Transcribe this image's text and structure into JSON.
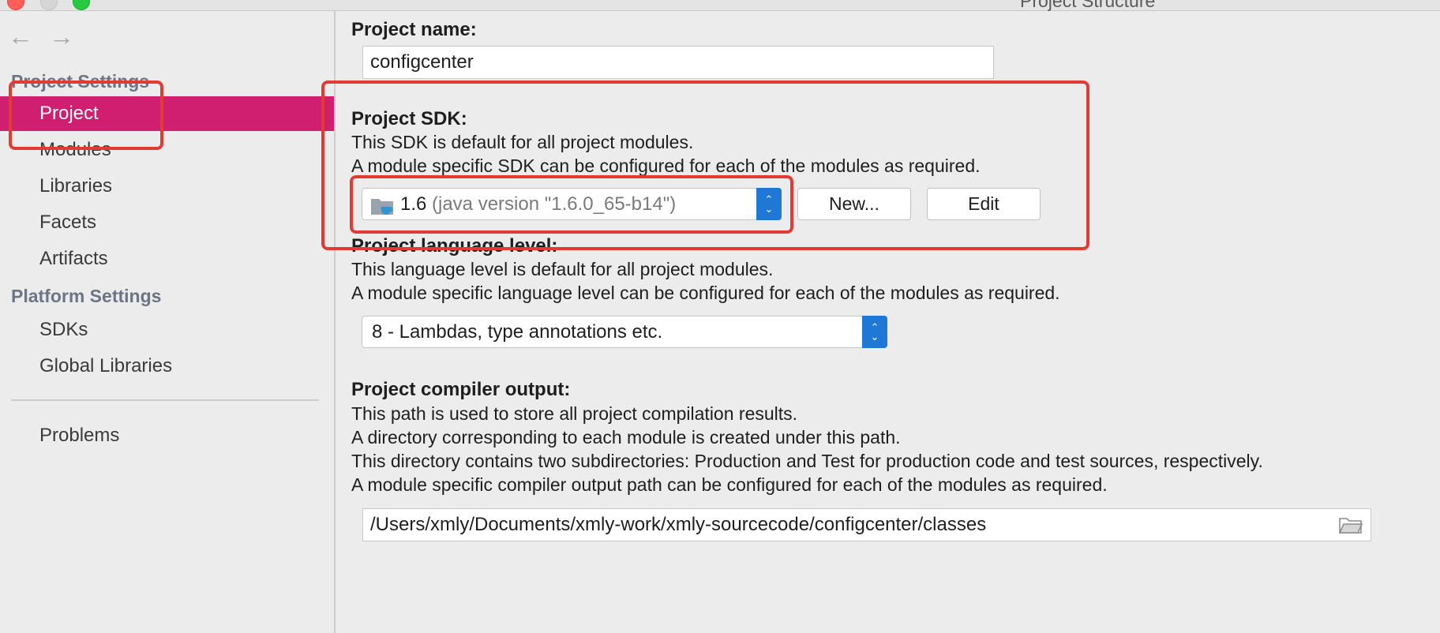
{
  "window": {
    "title": "Project Structure"
  },
  "nav": {
    "back_icon": "←",
    "forward_icon": "→"
  },
  "sidebar": {
    "project_settings_header": "Project Settings",
    "project_settings_items": [
      "Project",
      "Modules",
      "Libraries",
      "Facets",
      "Artifacts"
    ],
    "platform_settings_header": "Platform Settings",
    "platform_settings_items": [
      "SDKs",
      "Global Libraries"
    ],
    "problems": "Problems",
    "selected_color": "#d01f71"
  },
  "project_name": {
    "label": "Project name:",
    "value": "configcenter"
  },
  "project_sdk": {
    "label": "Project SDK:",
    "desc1": "This SDK is default for all project modules.",
    "desc2": "A module specific SDK can be configured for each of the modules as required.",
    "selected_version": "1.6",
    "selected_detail": "(java version \"1.6.0_65-b14\")",
    "new_button": "New...",
    "edit_button": "Edit"
  },
  "language_level": {
    "label": "Project language level:",
    "desc1": "This language level is default for all project modules.",
    "desc2": "A module specific language level can be configured for each of the modules as required.",
    "value": "8 - Lambdas, type annotations etc."
  },
  "compiler_output": {
    "label": "Project compiler output:",
    "desc1": "This path is used to store all project compilation results.",
    "desc2": "A directory corresponding to each module is created under this path.",
    "desc3": "This directory contains two subdirectories: Production and Test for production code and test sources, respectively.",
    "desc4": "A module specific compiler output path can be configured for each of the modules as required.",
    "path": "/Users/xmly/Documents/xmly-work/xmly-sourcecode/configcenter/classes"
  },
  "colors": {
    "accent_blue": "#1f77d6",
    "annotation_red": "#e23b33"
  }
}
